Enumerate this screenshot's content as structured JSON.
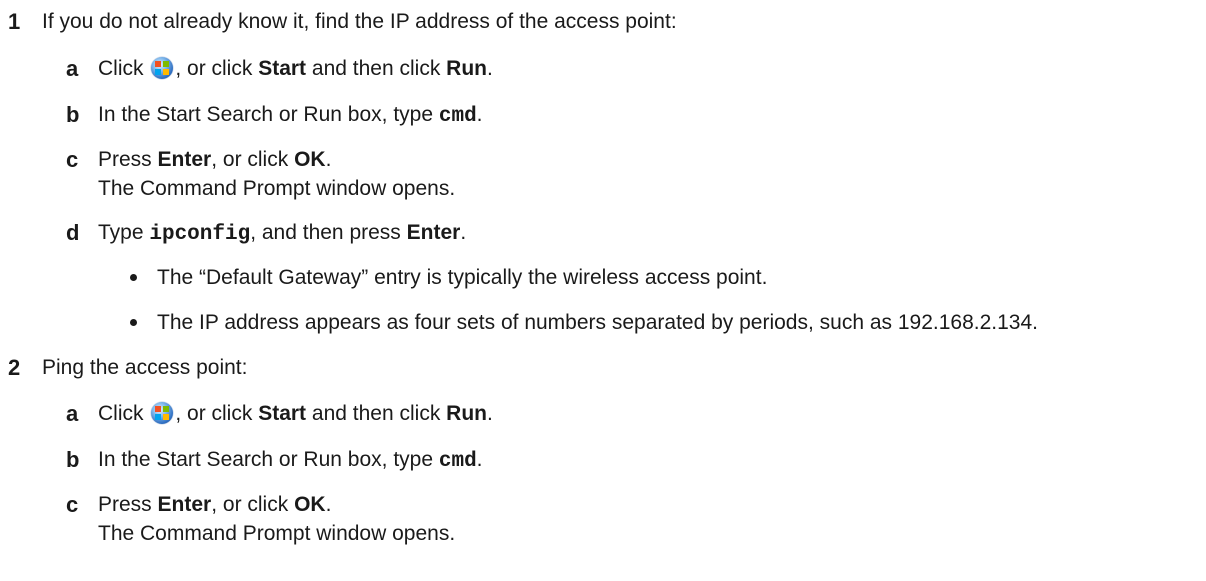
{
  "steps": [
    {
      "number": "1",
      "text": "If you do not already know it, find the IP address of the access point:",
      "substeps": [
        {
          "letter": "a",
          "click": "Click",
          "mid": ", or click",
          "start": "Start",
          "then": "and then click",
          "run": "Run",
          "end": "."
        },
        {
          "letter": "b",
          "prefix": "In the Start Search or Run box, type",
          "code": "cmd",
          "end": "."
        },
        {
          "letter": "c",
          "press": "Press",
          "enter": "Enter",
          "mid": ", or click",
          "ok": "OK",
          "end": ".",
          "result": "The Command Prompt window opens."
        },
        {
          "letter": "d",
          "type": "Type",
          "code": "ipconfig",
          "mid": ", and then press",
          "enter": "Enter",
          "end": ".",
          "bullets": [
            "The “Default Gateway” entry is typically the wireless access point.",
            "The IP address appears as four sets of numbers separated by periods, such as 192.168.2.134."
          ]
        }
      ]
    },
    {
      "number": "2",
      "text": "Ping the access point:",
      "substeps": [
        {
          "letter": "a",
          "click": "Click",
          "mid": ", or click",
          "start": "Start",
          "then": "and then click",
          "run": "Run",
          "end": "."
        },
        {
          "letter": "b",
          "prefix": "In the Start Search or Run box, type",
          "code": "cmd",
          "end": "."
        },
        {
          "letter": "c",
          "press": "Press",
          "enter": "Enter",
          "mid": ", or click",
          "ok": "OK",
          "end": ".",
          "result": "The Command Prompt window opens."
        }
      ]
    }
  ],
  "icons": {
    "start_orb": "windows-start-orb-icon"
  }
}
